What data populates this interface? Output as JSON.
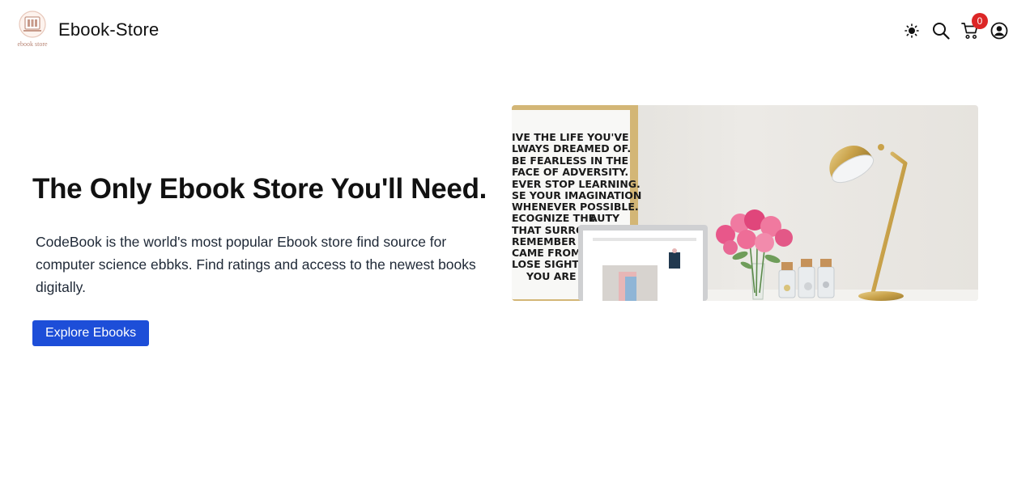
{
  "header": {
    "logo_text": "ebook store",
    "brand": "Ebook-Store",
    "cart_count": "0",
    "icons": [
      "sun-icon",
      "search-icon",
      "cart-icon",
      "user-account-icon"
    ]
  },
  "hero": {
    "title": "The Only Ebook Store You'll Need.",
    "description": "CodeBook is the world's most popular Ebook store find source for computer science ebbks. Find ratings and access to the newest books digitally.",
    "cta_label": "Explore Ebooks",
    "poster_lines": [
      "IVE THE LIFE YOU'VE",
      "LWAYS DREAMED OF.",
      "BE FEARLESS IN THE",
      "FACE OF ADVERSITY.",
      "EVER STOP LEARNING.",
      "SE YOUR IMAGINATION",
      "WHENEVER POSSIBLE.",
      "ECOGNIZE THE",
      "AUTY",
      "THAT SURROUN",
      "REMEMBER WHI",
      "CAME FROM, BU",
      "LOSE SIGHT OF",
      "YOU ARE GO"
    ]
  },
  "colors": {
    "accent": "#1d4ed8",
    "badge": "#dc2626",
    "text": "#111111"
  }
}
